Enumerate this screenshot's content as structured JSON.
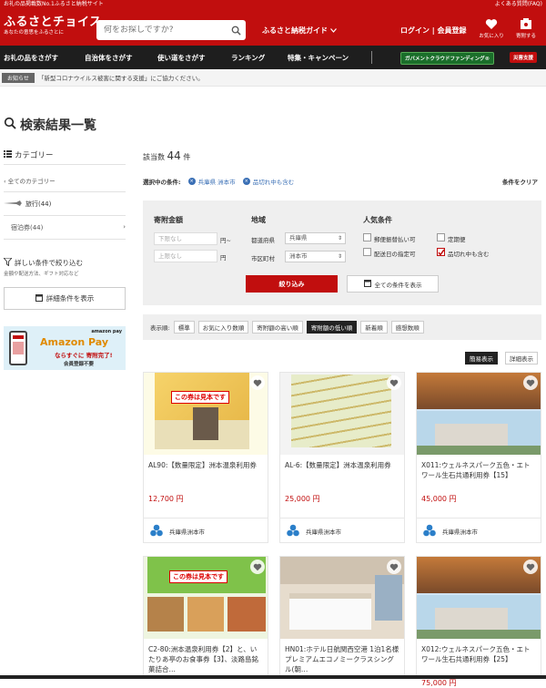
{
  "topbar": {
    "left": "お礼の品掲載数No.1ふるさと納税サイト",
    "right": "よくある質問(FAQ)"
  },
  "header": {
    "logo_main": "ふるさとチョイス",
    "logo_sub": "あなたの意思をふるさとに",
    "search_placeholder": "何をお探しですか?",
    "guide": "ふるさと納税ガイド",
    "login": "ログイン",
    "register": "会員登録",
    "favorites": "お気に入り",
    "donate": "寄附する"
  },
  "nav": {
    "items": [
      "お礼の品をさがす",
      "自治体をさがす",
      "使い道をさがす",
      "ランキング",
      "特集・キャンペーン"
    ],
    "gov": "ガバメントクラウドファンディング®",
    "disaster": "災害支援"
  },
  "notice": {
    "badge": "お知らせ",
    "text": "「新型コロナウイルス被害に関する支援」にご協力ください。"
  },
  "page_title": "検索結果一覧",
  "sidebar": {
    "category_title": "カテゴリー",
    "all_categories": "全てのカテゴリー",
    "travel": "旅行(44)",
    "lodging": "宿泊券(44)",
    "detail_title": "詳しい条件で絞り込む",
    "detail_sub": "金額や配送方法、ギフト対応など",
    "detail_button": "詳細条件を表示",
    "amazon_brand": "amazon pay",
    "amazon_title": "Amazon Pay",
    "amazon_line1": "ならすぐに 寄附完了!",
    "amazon_line2": "会員登録不要"
  },
  "results": {
    "prefix": "該当数",
    "count": "44",
    "unit": "件"
  },
  "filters": {
    "label": "選択中の条件:",
    "chips": [
      "兵庫県 洲本市",
      "品切れ中も含む"
    ],
    "clear": "条件をクリア"
  },
  "panel": {
    "amount_label": "寄附金額",
    "min_placeholder": "下限なし",
    "max_placeholder": "上限なし",
    "yen_from": "円~",
    "yen": "円",
    "region_label": "地域",
    "pref_label": "都道府県",
    "pref_value": "兵庫県",
    "city_label": "市区町村",
    "city_value": "洲本市",
    "popular_label": "人気条件",
    "options": [
      "郵便振替払い可",
      "定期便",
      "配送日の指定可",
      "品切れ中も含む"
    ],
    "narrow_button": "絞り込み",
    "all_conditions": "全ての条件を表示"
  },
  "sort": {
    "label": "表示順:",
    "items": [
      "標準",
      "お気に入り数順",
      "寄附額の高い順",
      "寄附額の低い順",
      "新着順",
      "感想数順"
    ],
    "active": 3
  },
  "view": {
    "simple": "簡易表示",
    "detail": "詳細表示"
  },
  "products": [
    {
      "name": "AL90:【数量限定】洲本温泉利用券",
      "price": "12,700 円",
      "muni": "兵庫県洲本市"
    },
    {
      "name": "AL-6:【数量限定】洲本温泉利用券",
      "price": "25,000 円",
      "muni": "兵庫県洲本市"
    },
    {
      "name": "X011:ウェルネスパーク五色・エトワール生石共通利用券【15】",
      "price": "45,000 円",
      "muni": "兵庫県洲本市"
    },
    {
      "name": "C2-80:洲本温泉利用券【2】と、いたりあ亭のお食事券【3】、淡路島銘菓詰合…",
      "price": "",
      "muni": ""
    },
    {
      "name": "HN01:ホテル日航関西空港 1泊1名様プレミアムエコノミークラスシングル(朝…",
      "price": "",
      "muni": ""
    },
    {
      "name": "X012:ウェルネスパーク五色・エトワール生石共通利用券【25】",
      "price": "75,000 円",
      "muni": ""
    }
  ],
  "coupon_text": "この券は見本です",
  "colors": {
    "brand": "#c10e0e",
    "nav": "#1e1e1e",
    "price": "#c10e0e"
  }
}
